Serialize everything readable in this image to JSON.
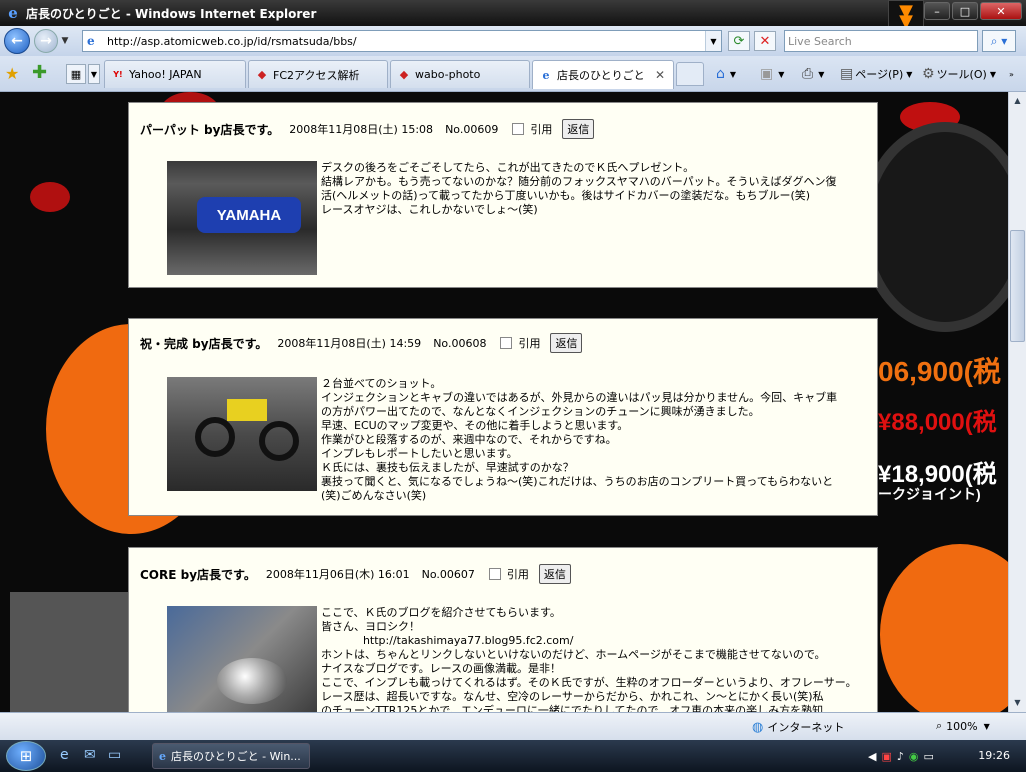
{
  "window": {
    "title": "店長のひとりごと - Windows Internet Explorer",
    "minimize": "–",
    "maximize": "□",
    "close": "✕"
  },
  "address": {
    "url": "http://asp.atomicweb.co.jp/id/rsmatsuda/bbs/",
    "search_placeholder": "Live Search"
  },
  "tabs": [
    {
      "label": "Yahoo! JAPAN",
      "icon": "Y!"
    },
    {
      "label": "FC2アクセス解析",
      "icon": "◆"
    },
    {
      "label": "wabo-photo",
      "icon": "◆"
    },
    {
      "label": "店長のひとりごと",
      "icon": "e",
      "active": true
    }
  ],
  "toolbar": {
    "page_label": "ページ(P)",
    "tools_label": "ツール(O)"
  },
  "posts": [
    {
      "title": "パーパット by店長です。",
      "date": "2008年11月08日(土) 15:08",
      "no": "No.00609",
      "cite": "引用",
      "reply": "返信",
      "body": [
        "デスクの後ろをごそごそしてたら、これが出てきたのでＫ氏へプレゼント。",
        "結構レアかも。もう売ってないのかな？随分前のフォックスヤマハのバーパット。そういえばダグヘン復",
        "活(ヘルメットの話)って載ってたから丁度いいかも。後はサイドカバーの塗装だな。もちブルー(笑)",
        "レースオヤジは、これしかないでしょ～(笑)"
      ],
      "image_text": "YAMAHA"
    },
    {
      "title": "祝・完成 by店長です。",
      "date": "2008年11月08日(土) 14:59",
      "no": "No.00608",
      "cite": "引用",
      "reply": "返信",
      "body": [
        "２台並べてのショット。",
        "インジェクションとキャブの違いではあるが、外見からの違いはパッ見は分かりません。今回、キャブ車",
        "の方がパワー出てたので、なんとなくインジェクションのチューンに興味が湧きました。",
        "早速、ECUのマップ変更や、その他に着手しようと思います。",
        "作業がひと段落するのが、来週中なので、それからですね。",
        "インプレもレポートしたいと思います。",
        "Ｋ氏には、裏技も伝えましたが、早速試すのかな？",
        "裏技って聞くと、気になるでしょうね～(笑)これだけは、うちのお店のコンプリート買ってもらわないと",
        "(笑)ごめんなさい(笑)"
      ]
    },
    {
      "title": "CORE by店長です。",
      "date": "2008年11月06日(木) 16:01",
      "no": "No.00607",
      "cite": "引用",
      "reply": "返信",
      "body": [
        "ここで、Ｋ氏のブログを紹介させてもらいます。",
        "皆さん、ヨロシク！",
        "            http://takashimaya77.blog95.fc2.com/",
        "ホントは、ちゃんとリンクしないといけないのだけど、ホームページがそこまで機能させてないので。",
        "ナイスなブログです。レースの画像満載。是非！",
        "ここで、インプレも載っけてくれるはず。そのＫ氏ですが、生粋のオフローダーというより、オフレーサー。",
        "レース歴は、超長いですな。なんせ、空冷のレーサーからだから、かれこれ、ン～とにかく長い(笑)私",
        "のチューンTTR125とかで、エンデューロに一緒にでたりしてたので、オフ車の本来の楽しみ方を熟知"
      ]
    }
  ],
  "background": {
    "prices": [
      "06,900(税",
      "¥88,000(税",
      "¥18,900(税",
      "ークジョイント)"
    ]
  },
  "status": {
    "zone": "インターネット",
    "zoom": "100%"
  },
  "taskbar": {
    "task_label": "店長のひとりごと - Win...",
    "clock": "19:26"
  }
}
